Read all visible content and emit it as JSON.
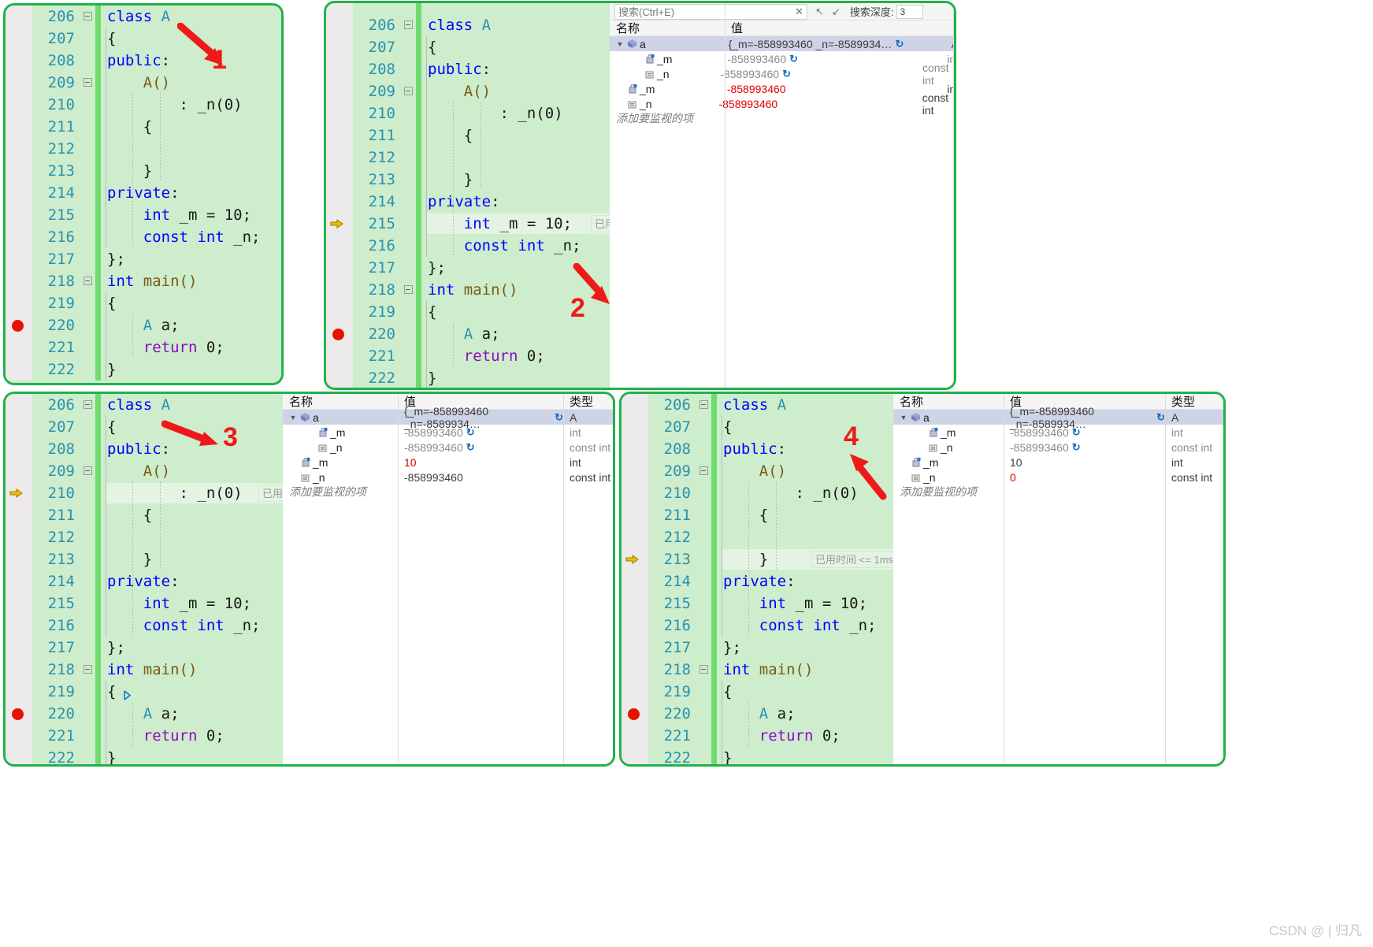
{
  "watermark": "CSDN @ | 归凡",
  "code": {
    "lines": [
      {
        "no": "206",
        "text": "class A",
        "fold": true,
        "tokens": [
          {
            "t": "class",
            "c": "kw"
          },
          {
            "t": " ",
            "c": "pl"
          },
          {
            "t": "A",
            "c": "typ"
          }
        ]
      },
      {
        "no": "207",
        "text": "{",
        "tokens": [
          {
            "t": "{",
            "c": "pl"
          }
        ]
      },
      {
        "no": "208",
        "text": "public:",
        "tokens": [
          {
            "t": "public",
            "c": "kw"
          },
          {
            "t": ":",
            "c": "pl"
          }
        ]
      },
      {
        "no": "209",
        "text": "    A()",
        "fold": true,
        "tokens": [
          {
            "t": "    ",
            "c": "pl"
          },
          {
            "t": "A()",
            "c": "fn"
          }
        ]
      },
      {
        "no": "210",
        "text": "        : _n(0)",
        "tokens": [
          {
            "t": "        : ",
            "c": "pl"
          },
          {
            "t": "_n",
            "c": "pl"
          },
          {
            "t": "(",
            "c": "pl"
          },
          {
            "t": "0",
            "c": "pl"
          },
          {
            "t": ")",
            "c": "pl"
          }
        ]
      },
      {
        "no": "211",
        "text": "    {",
        "tokens": [
          {
            "t": "    {",
            "c": "pl"
          }
        ]
      },
      {
        "no": "212",
        "text": "",
        "tokens": []
      },
      {
        "no": "213",
        "text": "    }",
        "tokens": [
          {
            "t": "    }",
            "c": "pl"
          }
        ]
      },
      {
        "no": "214",
        "text": "private:",
        "tokens": [
          {
            "t": "private",
            "c": "kw"
          },
          {
            "t": ":",
            "c": "pl"
          }
        ]
      },
      {
        "no": "215",
        "text": "    int _m = 10;",
        "tokens": [
          {
            "t": "    ",
            "c": "pl"
          },
          {
            "t": "int",
            "c": "kw"
          },
          {
            "t": " _m = 10;",
            "c": "pl"
          }
        ]
      },
      {
        "no": "216",
        "text": "    const int _n;",
        "tokens": [
          {
            "t": "    ",
            "c": "pl"
          },
          {
            "t": "const int",
            "c": "kw"
          },
          {
            "t": " _n;",
            "c": "pl"
          }
        ]
      },
      {
        "no": "217",
        "text": "};",
        "tokens": [
          {
            "t": "};",
            "c": "pl"
          }
        ]
      },
      {
        "no": "218",
        "text": "int main()",
        "fold": true,
        "tokens": [
          {
            "t": "int",
            "c": "kw"
          },
          {
            "t": " ",
            "c": "pl"
          },
          {
            "t": "main()",
            "c": "fn"
          }
        ]
      },
      {
        "no": "219",
        "text": "{",
        "tokens": [
          {
            "t": "{",
            "c": "pl"
          }
        ]
      },
      {
        "no": "220",
        "text": "    A a;",
        "tokens": [
          {
            "t": "    ",
            "c": "pl"
          },
          {
            "t": "A",
            "c": "typ"
          },
          {
            "t": " a;",
            "c": "pl"
          }
        ]
      },
      {
        "no": "221",
        "text": "    return 0;",
        "tokens": [
          {
            "t": "    ",
            "c": "ret"
          },
          {
            "t": "return",
            "c": "ret"
          },
          {
            "t": " 0;",
            "c": "pl"
          }
        ]
      },
      {
        "no": "222",
        "text": "}",
        "tokens": [
          {
            "t": "}",
            "c": "pl"
          }
        ]
      }
    ]
  },
  "panels": [
    {
      "label": "1",
      "breakpoint_line": "220",
      "current_line": null,
      "caret_line": "222",
      "has_watch": false,
      "partial_top_line": null,
      "inline_tip": null
    },
    {
      "label": "2",
      "breakpoint_line": "220",
      "current_line": "215",
      "has_watch": true,
      "partial_top_line": "205",
      "inline_tip": {
        "line": "215",
        "text": "已用时"
      }
    },
    {
      "label": "3",
      "breakpoint_line": "220",
      "current_line": "210",
      "has_watch": true,
      "partial_top_line": null,
      "inline_tip": {
        "line": "210",
        "text": "已用时"
      },
      "run_to_cursor_line": "219"
    },
    {
      "label": "4",
      "breakpoint_line": "220",
      "current_line": "213",
      "has_watch": true,
      "partial_top_line": null,
      "inline_tip": {
        "line": "213",
        "text": "已用时间 <= 1ms"
      }
    }
  ],
  "watch": {
    "toolbar": {
      "search_placeholder": "搜索(Ctrl+E)",
      "prev_label": "↖",
      "next_label": "↙",
      "depth_label": "搜索深度:",
      "depth_value": "3"
    },
    "columns": {
      "name": "名称",
      "value": "值",
      "type": "类型"
    },
    "add_watch": "添加要监视的项",
    "variants": {
      "before_init": {
        "rows": [
          {
            "indent": 0,
            "expander": "▼",
            "icon": "obj-icon",
            "name": "a",
            "value": "{_m=-858993460 _n=-8589934…",
            "type": "A",
            "refresh": true,
            "selected": true,
            "dim": false,
            "red": false
          },
          {
            "indent": 1,
            "expander": "",
            "icon": "field-private-icon",
            "name": "_m",
            "value": "-858993460",
            "type": "int",
            "refresh": true,
            "selected": false,
            "dim": true,
            "red": false
          },
          {
            "indent": 1,
            "expander": "",
            "icon": "field-const-icon",
            "name": "_n",
            "value": "-858993460",
            "type": "const int",
            "refresh": true,
            "selected": false,
            "dim": true,
            "red": false
          },
          {
            "indent": 0,
            "expander": "",
            "icon": "field-private-icon",
            "name": "_m",
            "value": "-858993460",
            "type": "int",
            "refresh": false,
            "selected": false,
            "dim": false,
            "red": true
          },
          {
            "indent": 0,
            "expander": "",
            "icon": "field-const-icon",
            "name": "_n",
            "value": "-858993460",
            "type": "const int",
            "refresh": false,
            "selected": false,
            "dim": false,
            "red": true
          }
        ]
      },
      "n_initialized": {
        "rows": [
          {
            "indent": 0,
            "expander": "▼",
            "icon": "obj-icon",
            "name": "a",
            "value": "{_m=-858993460 _n=-8589934…",
            "type": "A",
            "refresh": true,
            "selected": true,
            "dim": false,
            "red": false
          },
          {
            "indent": 1,
            "expander": "",
            "icon": "field-private-icon",
            "name": "_m",
            "value": "-858993460",
            "type": "int",
            "refresh": true,
            "selected": false,
            "dim": true,
            "red": false
          },
          {
            "indent": 1,
            "expander": "",
            "icon": "field-const-icon",
            "name": "_n",
            "value": "-858993460",
            "type": "const int",
            "refresh": true,
            "selected": false,
            "dim": true,
            "red": false
          },
          {
            "indent": 0,
            "expander": "",
            "icon": "field-private-icon",
            "name": "_m",
            "value": "10",
            "type": "int",
            "refresh": false,
            "selected": false,
            "dim": false,
            "red": true
          },
          {
            "indent": 0,
            "expander": "",
            "icon": "field-const-icon",
            "name": "_n",
            "value": "-858993460",
            "type": "const int",
            "refresh": false,
            "selected": false,
            "dim": false,
            "red": false
          }
        ]
      },
      "both_initialized": {
        "rows": [
          {
            "indent": 0,
            "expander": "▼",
            "icon": "obj-icon",
            "name": "a",
            "value": "{_m=-858993460 _n=-8589934…",
            "type": "A",
            "refresh": true,
            "selected": true,
            "dim": false,
            "red": false
          },
          {
            "indent": 1,
            "expander": "",
            "icon": "field-private-icon",
            "name": "_m",
            "value": "-858993460",
            "type": "int",
            "refresh": true,
            "selected": false,
            "dim": true,
            "red": false
          },
          {
            "indent": 1,
            "expander": "",
            "icon": "field-const-icon",
            "name": "_n",
            "value": "-858993460",
            "type": "const int",
            "refresh": true,
            "selected": false,
            "dim": true,
            "red": false
          },
          {
            "indent": 0,
            "expander": "",
            "icon": "field-private-icon",
            "name": "_m",
            "value": "10",
            "type": "int",
            "refresh": false,
            "selected": false,
            "dim": false,
            "red": false
          },
          {
            "indent": 0,
            "expander": "",
            "icon": "field-const-icon",
            "name": "_n",
            "value": "0",
            "type": "const int",
            "refresh": false,
            "selected": false,
            "dim": false,
            "red": true
          }
        ]
      }
    }
  },
  "colors": {
    "frame_green": "#22b14c",
    "editor_bg": "#cdedcc",
    "changebar_green": "#6fdb6f",
    "lineno_blue": "#2b91af",
    "keyword_blue": "#0000ff",
    "breakpoint_red": "#e51400",
    "arrow_red": "#f01919",
    "watch_bg": "#f5f5f5"
  }
}
